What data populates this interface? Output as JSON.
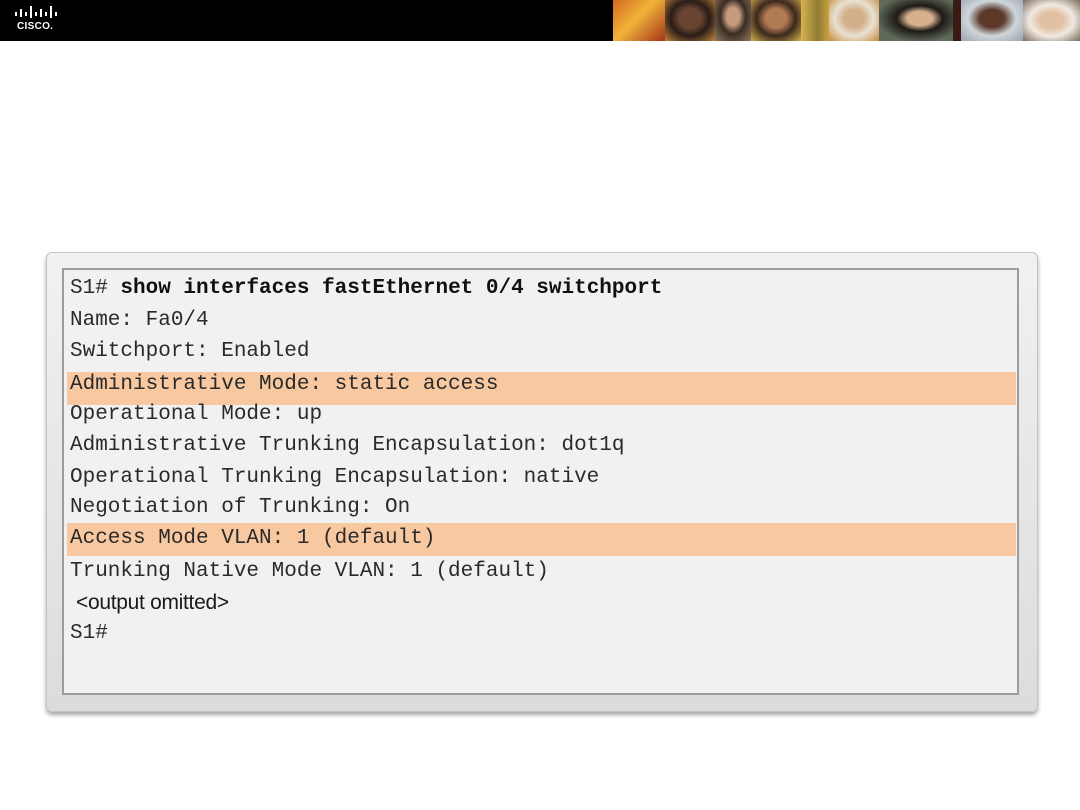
{
  "header": {
    "logo_text": "CISCO."
  },
  "terminal": {
    "prompt": "S1#",
    "command": "show interfaces fastEthernet 0/4 switchport",
    "lines": [
      "Name: Fa0/4",
      "Switchport: Enabled",
      "Administrative Mode: static access",
      "Operational Mode: up",
      "Administrative Trunking Encapsulation: dot1q",
      "Operational Trunking Encapsulation: native",
      "Negotiation of Trunking: On",
      "Access Mode VLAN: 1 (default)",
      "Trunking Native Mode VLAN: 1 (default)"
    ],
    "output_note": "<output omitted>",
    "final_prompt": "S1#"
  },
  "colors": {
    "highlight": "#f8c8a0",
    "panel_bg": "#f1f1f1",
    "header_bg": "#000000"
  }
}
